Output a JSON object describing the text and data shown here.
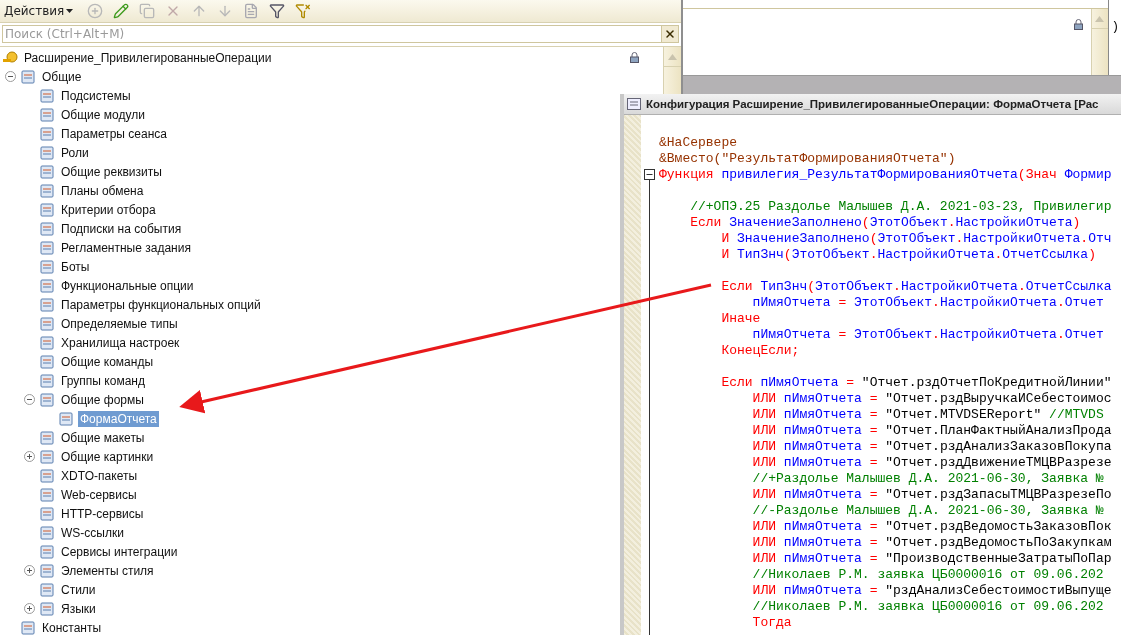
{
  "toolbar": {
    "actions_label": "Действия"
  },
  "search": {
    "placeholder": "Поиск (Ctrl+Alt+M)"
  },
  "tree": [
    {
      "label": "Расширение_ПривилегированныеОперации",
      "locked": true,
      "children": [
        {
          "label": "Общие",
          "expanded": true,
          "children": [
            {
              "label": "Подсистемы"
            },
            {
              "label": "Общие модули"
            },
            {
              "label": "Параметры сеанса"
            },
            {
              "label": "Роли"
            },
            {
              "label": "Общие реквизиты"
            },
            {
              "label": "Планы обмена"
            },
            {
              "label": "Критерии отбора"
            },
            {
              "label": "Подписки на события"
            },
            {
              "label": "Регламентные задания"
            },
            {
              "label": "Боты"
            },
            {
              "label": "Функциональные опции"
            },
            {
              "label": "Параметры функциональных опций"
            },
            {
              "label": "Определяемые типы"
            },
            {
              "label": "Хранилища настроек"
            },
            {
              "label": "Общие команды"
            },
            {
              "label": "Группы команд"
            },
            {
              "label": "Общие формы",
              "expanded": true,
              "children": [
                {
                  "label": "ФормаОтчета",
                  "selected": true
                }
              ]
            },
            {
              "label": "Общие макеты"
            },
            {
              "label": "Общие картинки",
              "expanded": false
            },
            {
              "label": "XDTO-пакеты"
            },
            {
              "label": "Web-сервисы"
            },
            {
              "label": "HTTP-сервисы"
            },
            {
              "label": "WS-ссылки"
            },
            {
              "label": "Сервисы интеграции"
            },
            {
              "label": "Элементы стиля",
              "expanded": false
            },
            {
              "label": "Стили"
            },
            {
              "label": "Языки",
              "expanded": false
            }
          ]
        },
        {
          "label": "Константы"
        }
      ]
    }
  ],
  "side_panel": {
    "edge_text": ")"
  },
  "code_window": {
    "title": "Конфигурация Расширение_ПривилегированныеОперации: ФормаОтчета [Рас",
    "lines": [
      {
        "tokens": [
          {
            "kind": "pre",
            "text": "&НаСервере"
          }
        ]
      },
      {
        "tokens": [
          {
            "kind": "pre",
            "text": "&Вместо(\"РезультатФормированияОтчета\")"
          }
        ]
      },
      {
        "fold": true,
        "tokens": [
          {
            "kind": "kw",
            "text": "Функция"
          },
          {
            "kind": "id",
            "text": " привилегия_РезультатФормированияОтчета"
          },
          {
            "kind": "op",
            "text": "("
          },
          {
            "kind": "kw",
            "text": "Знач"
          },
          {
            "kind": "id",
            "text": " Формир"
          }
        ]
      },
      {
        "blank_before": true,
        "tokens": [
          {
            "kind": "comment",
            "text": "    //+ОПЭ.25 Раздолье Малышев Д.А. 2021-03-23, Привилегир"
          }
        ]
      },
      {
        "tokens": [
          {
            "kind": "kw",
            "text": "    Если"
          },
          {
            "kind": "id",
            "text": " ЗначениеЗаполнено"
          },
          {
            "kind": "op",
            "text": "("
          },
          {
            "kind": "id",
            "text": "ЭтотОбъект"
          },
          {
            "kind": "op",
            "text": "."
          },
          {
            "kind": "id",
            "text": "НастройкиОтчета"
          },
          {
            "kind": "op",
            "text": ")"
          }
        ]
      },
      {
        "tokens": [
          {
            "kind": "kw",
            "text": "        И"
          },
          {
            "kind": "id",
            "text": " ЗначениеЗаполнено"
          },
          {
            "kind": "op",
            "text": "("
          },
          {
            "kind": "id",
            "text": "ЭтотОбъект"
          },
          {
            "kind": "op",
            "text": "."
          },
          {
            "kind": "id",
            "text": "НастройкиОтчета"
          },
          {
            "kind": "op",
            "text": "."
          },
          {
            "kind": "id",
            "text": "Отч"
          }
        ]
      },
      {
        "tokens": [
          {
            "kind": "kw",
            "text": "        И"
          },
          {
            "kind": "id",
            "text": " ТипЗнч"
          },
          {
            "kind": "op",
            "text": "("
          },
          {
            "kind": "id",
            "text": "ЭтотОбъект"
          },
          {
            "kind": "op",
            "text": "."
          },
          {
            "kind": "id",
            "text": "НастройкиОтчета"
          },
          {
            "kind": "op",
            "text": "."
          },
          {
            "kind": "id",
            "text": "ОтчетСсылка"
          },
          {
            "kind": "op",
            "text": ")"
          }
        ]
      },
      {
        "blank_before": true,
        "tokens": [
          {
            "kind": "kw",
            "text": "        Если"
          },
          {
            "kind": "id",
            "text": " ТипЗнч"
          },
          {
            "kind": "op",
            "text": "("
          },
          {
            "kind": "id",
            "text": "ЭтотОбъект"
          },
          {
            "kind": "op",
            "text": "."
          },
          {
            "kind": "id",
            "text": "НастройкиОтчета"
          },
          {
            "kind": "op",
            "text": "."
          },
          {
            "kind": "id",
            "text": "ОтчетСсылка"
          }
        ]
      },
      {
        "tokens": [
          {
            "kind": "id",
            "text": "            пИмяОтчета"
          },
          {
            "kind": "op",
            "text": " ="
          },
          {
            "kind": "id",
            "text": " ЭтотОбъект"
          },
          {
            "kind": "op",
            "text": "."
          },
          {
            "kind": "id",
            "text": "НастройкиОтчета"
          },
          {
            "kind": "op",
            "text": "."
          },
          {
            "kind": "id",
            "text": "Отчет"
          }
        ]
      },
      {
        "tokens": [
          {
            "kind": "kw",
            "text": "        Иначе"
          }
        ]
      },
      {
        "tokens": [
          {
            "kind": "id",
            "text": "            пИмяОтчета"
          },
          {
            "kind": "op",
            "text": " ="
          },
          {
            "kind": "id",
            "text": " ЭтотОбъект"
          },
          {
            "kind": "op",
            "text": "."
          },
          {
            "kind": "id",
            "text": "НастройкиОтчета"
          },
          {
            "kind": "op",
            "text": "."
          },
          {
            "kind": "id",
            "text": "Отчет"
          }
        ]
      },
      {
        "tokens": [
          {
            "kind": "kw",
            "text": "        КонецЕсли;"
          }
        ]
      },
      {
        "blank_before": true,
        "tokens": [
          {
            "kind": "kw",
            "text": "        Если"
          },
          {
            "kind": "id",
            "text": " пИмяОтчета"
          },
          {
            "kind": "op",
            "text": " ="
          },
          {
            "kind": "str",
            "text": " \"Отчет.рздОтчетПоКредитнойЛинии\""
          }
        ]
      },
      {
        "tokens": [
          {
            "kind": "kw",
            "text": "            ИЛИ"
          },
          {
            "kind": "id",
            "text": " пИмяОтчета"
          },
          {
            "kind": "op",
            "text": " ="
          },
          {
            "kind": "str",
            "text": " \"Отчет.рздВыручкаИСебестоимос"
          }
        ]
      },
      {
        "tokens": [
          {
            "kind": "kw",
            "text": "            ИЛИ"
          },
          {
            "kind": "id",
            "text": " пИмяОтчета"
          },
          {
            "kind": "op",
            "text": " ="
          },
          {
            "kind": "str",
            "text": " \"Отчет.MTVDSEReport\""
          },
          {
            "kind": "comment",
            "text": " //MTVDS"
          }
        ]
      },
      {
        "tokens": [
          {
            "kind": "kw",
            "text": "            ИЛИ"
          },
          {
            "kind": "id",
            "text": " пИмяОтчета"
          },
          {
            "kind": "op",
            "text": " ="
          },
          {
            "kind": "str",
            "text": " \"Отчет.ПланФактныйАнализПрода"
          }
        ]
      },
      {
        "tokens": [
          {
            "kind": "kw",
            "text": "            ИЛИ"
          },
          {
            "kind": "id",
            "text": " пИмяОтчета"
          },
          {
            "kind": "op",
            "text": " ="
          },
          {
            "kind": "str",
            "text": " \"Отчет.рздАнализЗаказовПокупа"
          }
        ]
      },
      {
        "tokens": [
          {
            "kind": "kw",
            "text": "            ИЛИ"
          },
          {
            "kind": "id",
            "text": " пИмяОтчета"
          },
          {
            "kind": "op",
            "text": " ="
          },
          {
            "kind": "str",
            "text": " \"Отчет.рздДвижениеТМЦВРазрезе"
          }
        ]
      },
      {
        "tokens": [
          {
            "kind": "comment",
            "text": "            //+Раздолье Малышев Д.А. 2021-06-30, Заявка №"
          }
        ]
      },
      {
        "tokens": [
          {
            "kind": "kw",
            "text": "            ИЛИ"
          },
          {
            "kind": "id",
            "text": " пИмяОтчета"
          },
          {
            "kind": "op",
            "text": " ="
          },
          {
            "kind": "str",
            "text": " \"Отчет.рздЗапасыТМЦВРазрезеПо"
          }
        ]
      },
      {
        "tokens": [
          {
            "kind": "comment",
            "text": "            //-Раздолье Малышев Д.А. 2021-06-30, Заявка №"
          }
        ]
      },
      {
        "tokens": [
          {
            "kind": "kw",
            "text": "            ИЛИ"
          },
          {
            "kind": "id",
            "text": " пИмяОтчета"
          },
          {
            "kind": "op",
            "text": " ="
          },
          {
            "kind": "str",
            "text": " \"Отчет.рздВедомостьЗаказовПок"
          }
        ]
      },
      {
        "tokens": [
          {
            "kind": "kw",
            "text": "            ИЛИ"
          },
          {
            "kind": "id",
            "text": " пИмяОтчета"
          },
          {
            "kind": "op",
            "text": " ="
          },
          {
            "kind": "str",
            "text": " \"Отчет.рздВедомостьПоЗакупкам"
          }
        ]
      },
      {
        "tokens": [
          {
            "kind": "kw",
            "text": "            ИЛИ"
          },
          {
            "kind": "id",
            "text": " пИмяОтчета"
          },
          {
            "kind": "op",
            "text": " ="
          },
          {
            "kind": "str",
            "text": " \"ПроизводственныеЗатратыПоПар"
          }
        ]
      },
      {
        "tokens": [
          {
            "kind": "comment",
            "text": "            //Николаев Р.М. заявка ЦБ0000016 от 09.06.202"
          }
        ]
      },
      {
        "tokens": [
          {
            "kind": "kw",
            "text": "            ИЛИ"
          },
          {
            "kind": "id",
            "text": " пИмяОтчета"
          },
          {
            "kind": "op",
            "text": " ="
          },
          {
            "kind": "str",
            "text": " \"рздАнализСебестоимостиВыпуще"
          }
        ]
      },
      {
        "tokens": [
          {
            "kind": "comment",
            "text": "            //Николаев Р.М. заявка ЦБ0000016 от 09.06.202"
          }
        ]
      },
      {
        "tokens": [
          {
            "kind": "kw",
            "text": "            Тогда"
          }
        ]
      }
    ]
  }
}
